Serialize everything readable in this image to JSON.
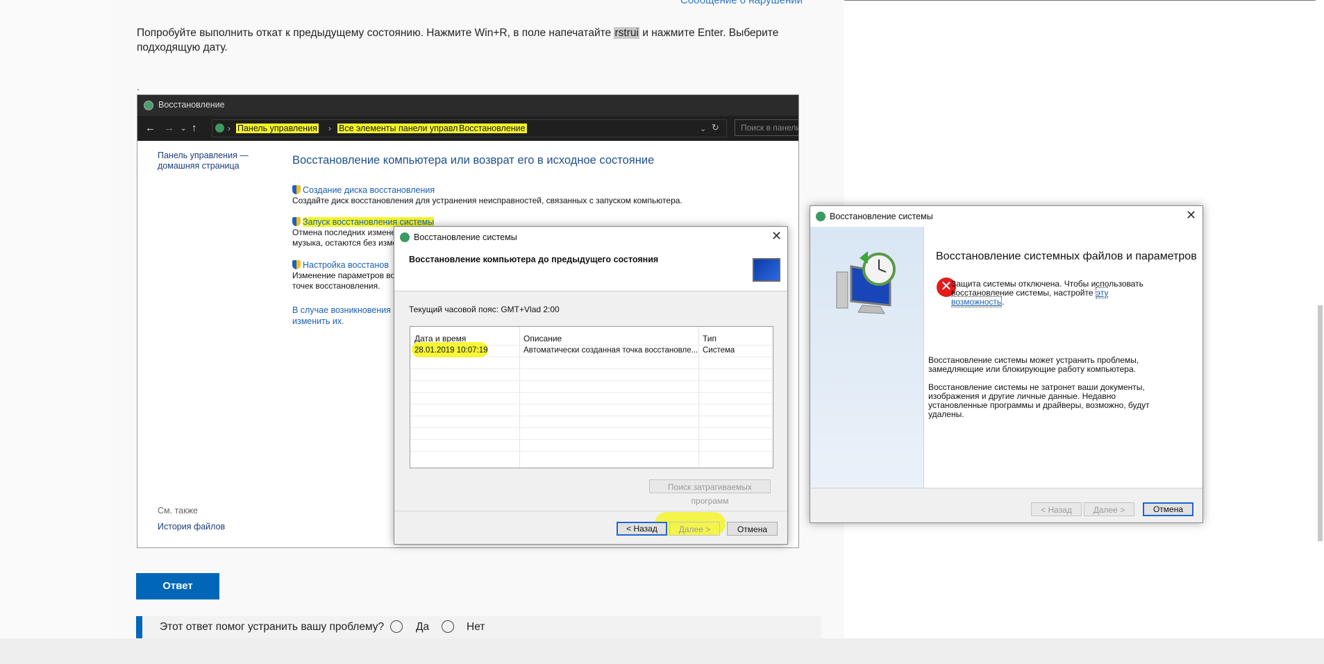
{
  "article": {
    "report_link": "Сообщение о нарушении",
    "intro_before": "Попробуйте выполнить откат к предыдущему состоянию. Нажмите Win+R, в поле напечатайте ",
    "intro_code": "rstrui",
    "intro_after": " и нажмите Enter. Выберите подходящую дату.",
    "dot": "."
  },
  "control_panel": {
    "window_title": "Восстановление",
    "breadcrumbs": [
      "Панель управления",
      "Все элементы панели управления",
      "Восстановление"
    ],
    "search_placeholder": "Поиск в панели",
    "home_link": "Панель управления — домашняя страница",
    "main_title": "Восстановление компьютера или возврат его в исходное состояние",
    "items": [
      {
        "link": "Создание диска восстановления",
        "desc": "Создайте диск восстановления для устранения неисправностей, связанных с запуском компьютера."
      },
      {
        "link": "Запуск восстановления системы",
        "desc_line1": "Отмена последних измене",
        "desc_line2": "музыка, остаются без изме"
      },
      {
        "link": "Настройка восстанов",
        "desc_line1": "Изменение параметров во",
        "desc_line2": "точек восстановления."
      }
    ],
    "extra_line1": "В случае возникновения н",
    "extra_line2": "изменить их.",
    "see_also": "См. также",
    "file_history": "История файлов"
  },
  "restore_dialog": {
    "title": "Восстановление системы",
    "heading": "Восстановление компьютера до предыдущего состояния",
    "timezone": "Текущий часовой пояс: GMT+Vlad 2:00",
    "columns": [
      "Дата и время",
      "Описание",
      "Тип"
    ],
    "rows": [
      {
        "date": "28.01.2019 10:07:19",
        "description": "Автоматически созданная точка восстановле...",
        "type": "Система"
      }
    ],
    "scan_button": "Поиск затрагиваемых программ",
    "back_button": "< Назад",
    "next_button": "Далее >",
    "cancel_button": "Отмена"
  },
  "system_restore_dialog": {
    "title": "Восстановление системы",
    "heading": "Восстановление системных файлов и параметров",
    "error_text": "Защита системы отключена. Чтобы использовать восстановление системы, настройте ",
    "error_link": "эту возможность",
    "error_end": ".",
    "para1": "Восстановление системы может устранить проблемы, замедляющие или блокирующие работу компьютера.",
    "para2": "Восстановление системы не затронет ваши документы, изображения и другие личные данные. Недавно установленные программы и драйверы, возможно, будут удалены.",
    "back_button": "< Назад",
    "next_button": "Далее >",
    "cancel_button": "Отмена"
  },
  "answer": {
    "button": "Ответ",
    "question": "Этот ответ помог устранить вашу проблему?",
    "yes": "Да",
    "no": "Нет"
  }
}
